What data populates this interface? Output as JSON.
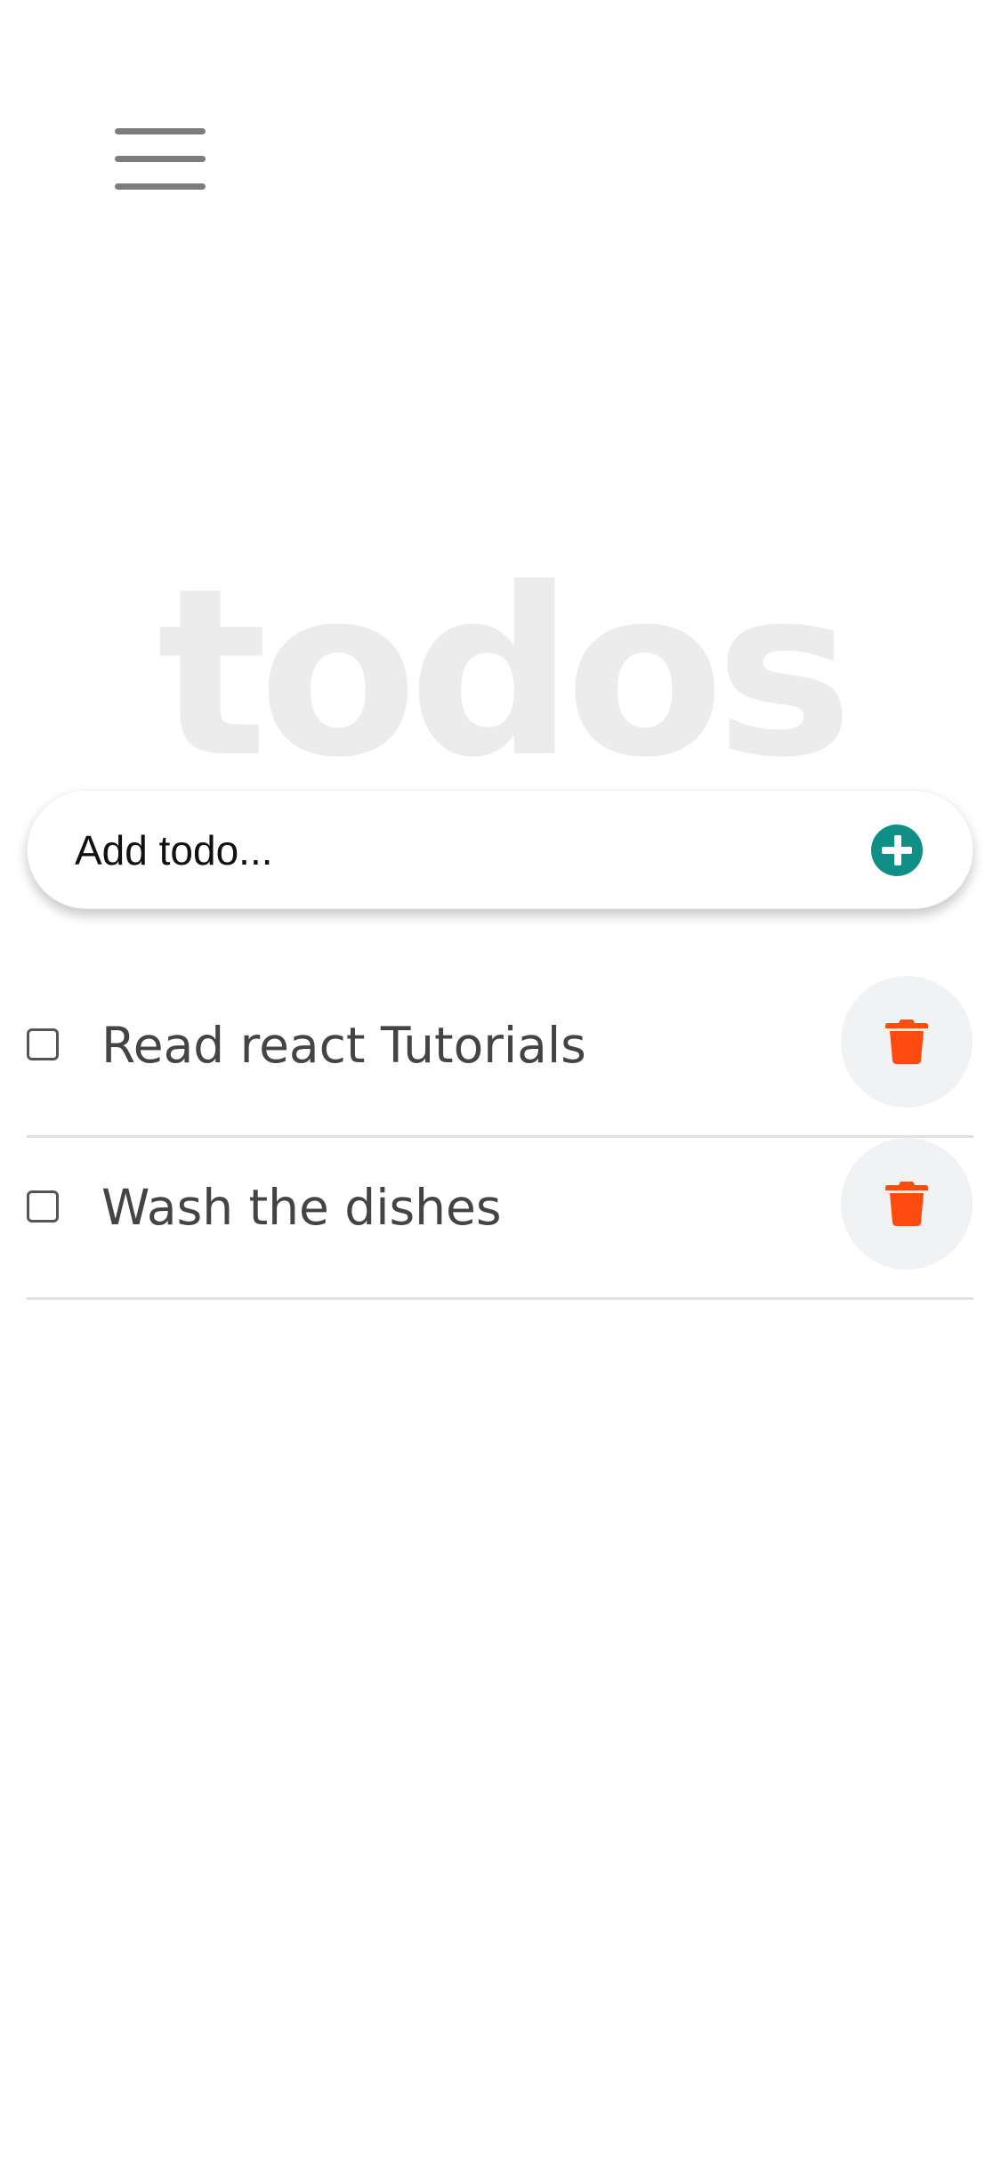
{
  "header": {
    "menu_icon": "hamburger-menu-icon"
  },
  "title": {
    "text": "todos"
  },
  "add_todo": {
    "placeholder": "Add todo...",
    "icon": "plus-circle-icon",
    "accent_color": "#108f86"
  },
  "todos": [
    {
      "text": "Read react Tutorials",
      "checked": false,
      "delete_icon": "trash-icon"
    },
    {
      "text": "Wash the dishes",
      "checked": false,
      "delete_icon": "trash-icon"
    }
  ],
  "colors": {
    "title": "#ececec",
    "text": "#444444",
    "delete": "#ff4b10",
    "delete_button_background": "#f1f2f3",
    "divider": "#e1e1e1"
  }
}
